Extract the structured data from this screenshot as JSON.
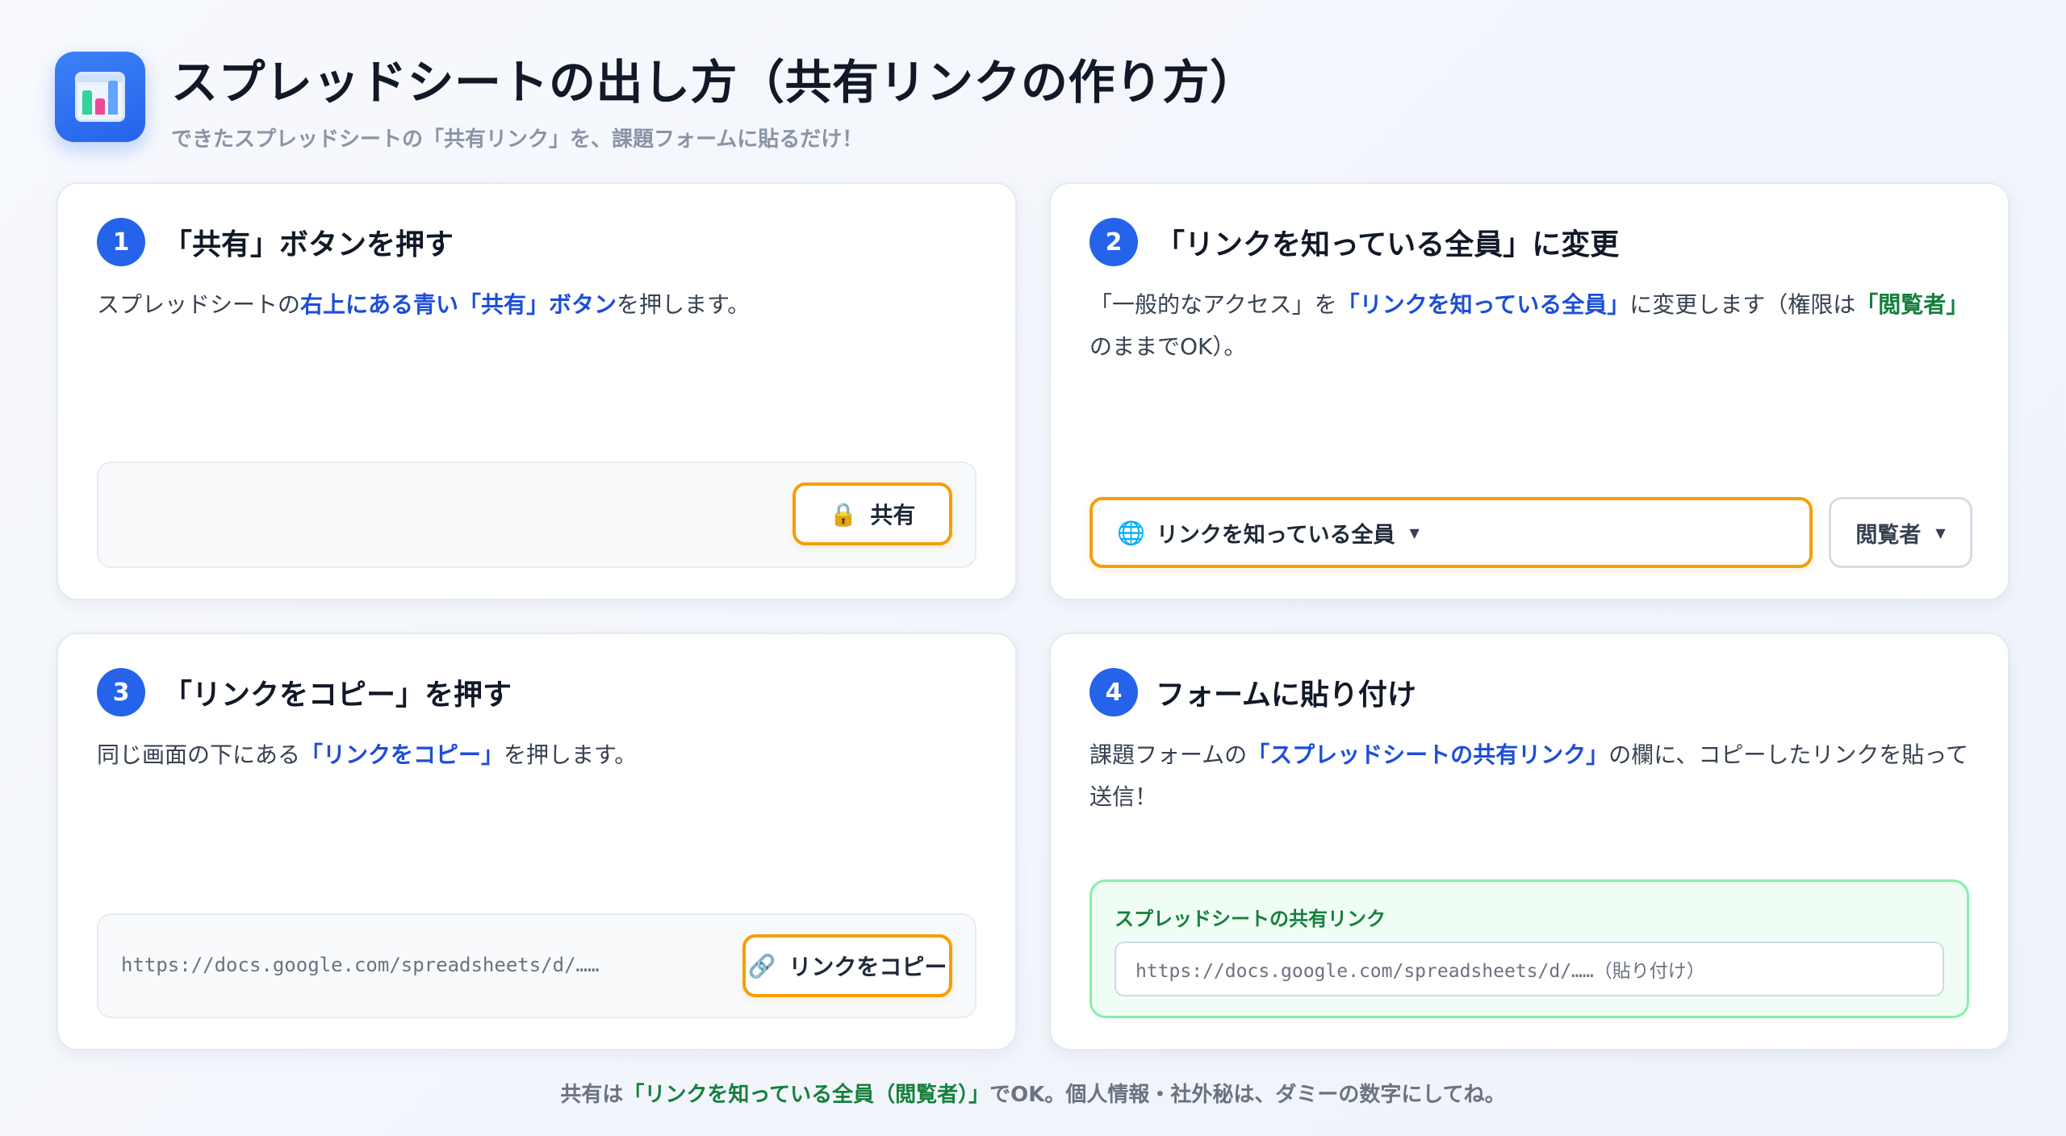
{
  "header": {
    "icon": "spreadsheet-chart-icon",
    "title": "スプレッドシートの出し方（共有リンクの作り方）",
    "subtitle": "できたスプレッドシートの「共有リンク」を、課題フォームに貼るだけ！"
  },
  "colors": {
    "accent": "#2563eb",
    "highlight": "#f59e0b",
    "success": "#15803d"
  },
  "steps": [
    {
      "number": "1",
      "title": "「共有」ボタンを押す",
      "desc": {
        "pre": "スプレッドシートの",
        "hl": "右上にある青い「共有」ボタン",
        "post": "を押します。"
      },
      "button": {
        "icon": "lock-icon",
        "label": "共有"
      }
    },
    {
      "number": "2",
      "title": "「リンクを知っている全員」に変更",
      "desc": {
        "pre": "「一般的なアクセス」を",
        "hl": "「リンクを知っている全員」",
        "mid": "に変更します（権限は",
        "hg": "「閲覧者」",
        "post": "のままでOK）。"
      },
      "access_select": {
        "icon": "globe-icon",
        "label": "リンクを知っている全員"
      },
      "role_select": {
        "label": "閲覧者"
      }
    },
    {
      "number": "3",
      "title": "「リンクをコピー」を押す",
      "desc": {
        "pre": "同じ画面の下にある",
        "hl": "「リンクをコピー」",
        "post": "を押します。"
      },
      "url": "https://docs.google.com/spreadsheets/d/……",
      "button": {
        "icon": "link-icon",
        "label": "リンクをコピー"
      }
    },
    {
      "number": "4",
      "title": "フォームに貼り付け",
      "desc": {
        "pre": "課題フォームの",
        "hl": "「スプレッドシートの共有リンク」",
        "post": "の欄に、コピーしたリンクを貼って送信！"
      },
      "form_label": "スプレッドシートの共有リンク",
      "form_placeholder": "https://docs.google.com/spreadsheets/d/……（貼り付け）"
    }
  ],
  "footer": {
    "pre": "共有は",
    "hg": "「リンクを知っている全員（閲覧者）」",
    "post": "でOK。個人情報・社外秘は、ダミーの数字にしてね。"
  }
}
